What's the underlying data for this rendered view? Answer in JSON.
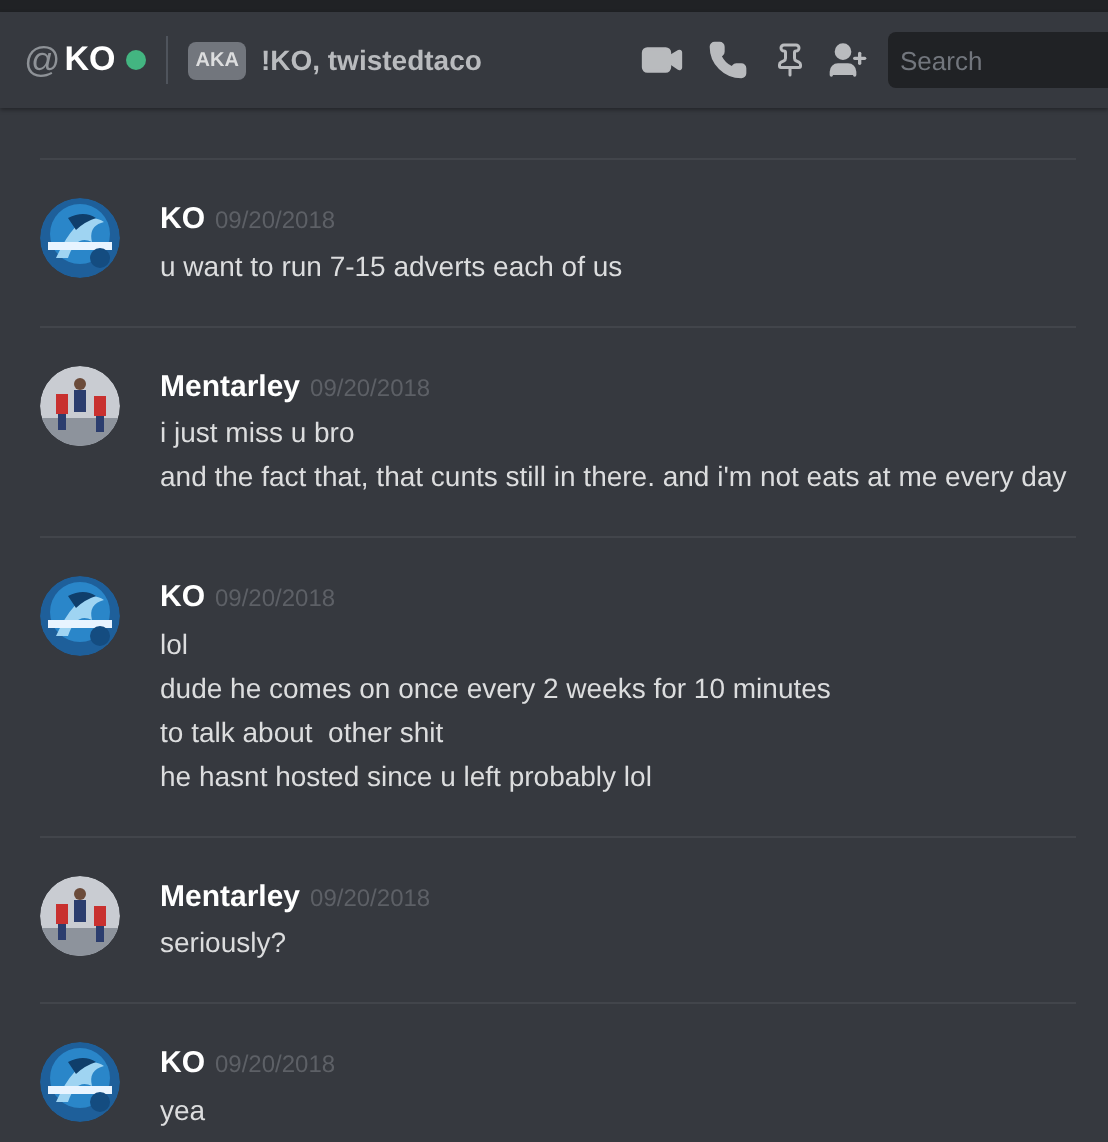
{
  "header": {
    "at": "@",
    "name": "KO",
    "online": true,
    "aka_badge": "AKA",
    "aka_names": "!KO, twistedtaco",
    "search": {
      "placeholder": "Search"
    }
  },
  "messages": [
    {
      "author": "KO",
      "timestamp": "09/20/2018",
      "avatar": {
        "kind": "dragon"
      },
      "lines": [
        "u want to run 7-15 adverts each of us"
      ]
    },
    {
      "author": "Mentarley",
      "timestamp": "09/20/2018",
      "avatar": {
        "kind": "figures"
      },
      "lines": [
        "i just miss u bro",
        "and the fact that, that cunts still in there. and i'm not eats at me every day"
      ]
    },
    {
      "author": "KO",
      "timestamp": "09/20/2018",
      "avatar": {
        "kind": "dragon"
      },
      "lines": [
        "lol",
        "dude he comes on once every 2 weeks for 10 minutes",
        "to talk about  other shit",
        "he hasnt hosted since u left probably lol"
      ]
    },
    {
      "author": "Mentarley",
      "timestamp": "09/20/2018",
      "avatar": {
        "kind": "figures"
      },
      "lines": [
        "seriously?"
      ]
    },
    {
      "author": "KO",
      "timestamp": "09/20/2018",
      "avatar": {
        "kind": "dragon"
      },
      "lines": [
        "yea"
      ]
    }
  ]
}
